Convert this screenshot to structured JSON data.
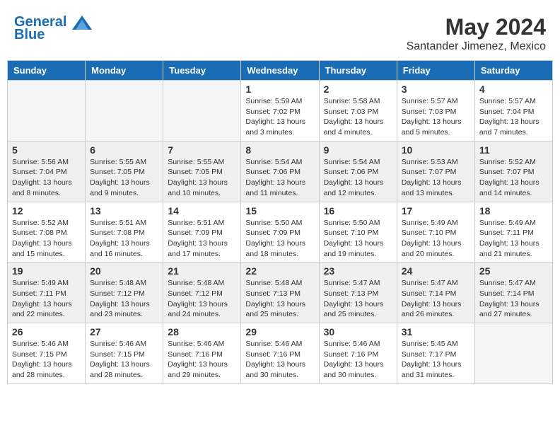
{
  "header": {
    "logo_line1": "General",
    "logo_line2": "Blue",
    "month": "May 2024",
    "location": "Santander Jimenez, Mexico"
  },
  "weekdays": [
    "Sunday",
    "Monday",
    "Tuesday",
    "Wednesday",
    "Thursday",
    "Friday",
    "Saturday"
  ],
  "weeks": [
    [
      {
        "day": "",
        "empty": true
      },
      {
        "day": "",
        "empty": true
      },
      {
        "day": "",
        "empty": true
      },
      {
        "day": "1",
        "sunrise": "Sunrise: 5:59 AM",
        "sunset": "Sunset: 7:02 PM",
        "daylight": "Daylight: 13 hours and 3 minutes."
      },
      {
        "day": "2",
        "sunrise": "Sunrise: 5:58 AM",
        "sunset": "Sunset: 7:03 PM",
        "daylight": "Daylight: 13 hours and 4 minutes."
      },
      {
        "day": "3",
        "sunrise": "Sunrise: 5:57 AM",
        "sunset": "Sunset: 7:03 PM",
        "daylight": "Daylight: 13 hours and 5 minutes."
      },
      {
        "day": "4",
        "sunrise": "Sunrise: 5:57 AM",
        "sunset": "Sunset: 7:04 PM",
        "daylight": "Daylight: 13 hours and 7 minutes."
      }
    ],
    [
      {
        "day": "5",
        "sunrise": "Sunrise: 5:56 AM",
        "sunset": "Sunset: 7:04 PM",
        "daylight": "Daylight: 13 hours and 8 minutes."
      },
      {
        "day": "6",
        "sunrise": "Sunrise: 5:55 AM",
        "sunset": "Sunset: 7:05 PM",
        "daylight": "Daylight: 13 hours and 9 minutes."
      },
      {
        "day": "7",
        "sunrise": "Sunrise: 5:55 AM",
        "sunset": "Sunset: 7:05 PM",
        "daylight": "Daylight: 13 hours and 10 minutes."
      },
      {
        "day": "8",
        "sunrise": "Sunrise: 5:54 AM",
        "sunset": "Sunset: 7:06 PM",
        "daylight": "Daylight: 13 hours and 11 minutes."
      },
      {
        "day": "9",
        "sunrise": "Sunrise: 5:54 AM",
        "sunset": "Sunset: 7:06 PM",
        "daylight": "Daylight: 13 hours and 12 minutes."
      },
      {
        "day": "10",
        "sunrise": "Sunrise: 5:53 AM",
        "sunset": "Sunset: 7:07 PM",
        "daylight": "Daylight: 13 hours and 13 minutes."
      },
      {
        "day": "11",
        "sunrise": "Sunrise: 5:52 AM",
        "sunset": "Sunset: 7:07 PM",
        "daylight": "Daylight: 13 hours and 14 minutes."
      }
    ],
    [
      {
        "day": "12",
        "sunrise": "Sunrise: 5:52 AM",
        "sunset": "Sunset: 7:08 PM",
        "daylight": "Daylight: 13 hours and 15 minutes."
      },
      {
        "day": "13",
        "sunrise": "Sunrise: 5:51 AM",
        "sunset": "Sunset: 7:08 PM",
        "daylight": "Daylight: 13 hours and 16 minutes."
      },
      {
        "day": "14",
        "sunrise": "Sunrise: 5:51 AM",
        "sunset": "Sunset: 7:09 PM",
        "daylight": "Daylight: 13 hours and 17 minutes."
      },
      {
        "day": "15",
        "sunrise": "Sunrise: 5:50 AM",
        "sunset": "Sunset: 7:09 PM",
        "daylight": "Daylight: 13 hours and 18 minutes."
      },
      {
        "day": "16",
        "sunrise": "Sunrise: 5:50 AM",
        "sunset": "Sunset: 7:10 PM",
        "daylight": "Daylight: 13 hours and 19 minutes."
      },
      {
        "day": "17",
        "sunrise": "Sunrise: 5:49 AM",
        "sunset": "Sunset: 7:10 PM",
        "daylight": "Daylight: 13 hours and 20 minutes."
      },
      {
        "day": "18",
        "sunrise": "Sunrise: 5:49 AM",
        "sunset": "Sunset: 7:11 PM",
        "daylight": "Daylight: 13 hours and 21 minutes."
      }
    ],
    [
      {
        "day": "19",
        "sunrise": "Sunrise: 5:49 AM",
        "sunset": "Sunset: 7:11 PM",
        "daylight": "Daylight: 13 hours and 22 minutes."
      },
      {
        "day": "20",
        "sunrise": "Sunrise: 5:48 AM",
        "sunset": "Sunset: 7:12 PM",
        "daylight": "Daylight: 13 hours and 23 minutes."
      },
      {
        "day": "21",
        "sunrise": "Sunrise: 5:48 AM",
        "sunset": "Sunset: 7:12 PM",
        "daylight": "Daylight: 13 hours and 24 minutes."
      },
      {
        "day": "22",
        "sunrise": "Sunrise: 5:48 AM",
        "sunset": "Sunset: 7:13 PM",
        "daylight": "Daylight: 13 hours and 25 minutes."
      },
      {
        "day": "23",
        "sunrise": "Sunrise: 5:47 AM",
        "sunset": "Sunset: 7:13 PM",
        "daylight": "Daylight: 13 hours and 25 minutes."
      },
      {
        "day": "24",
        "sunrise": "Sunrise: 5:47 AM",
        "sunset": "Sunset: 7:14 PM",
        "daylight": "Daylight: 13 hours and 26 minutes."
      },
      {
        "day": "25",
        "sunrise": "Sunrise: 5:47 AM",
        "sunset": "Sunset: 7:14 PM",
        "daylight": "Daylight: 13 hours and 27 minutes."
      }
    ],
    [
      {
        "day": "26",
        "sunrise": "Sunrise: 5:46 AM",
        "sunset": "Sunset: 7:15 PM",
        "daylight": "Daylight: 13 hours and 28 minutes."
      },
      {
        "day": "27",
        "sunrise": "Sunrise: 5:46 AM",
        "sunset": "Sunset: 7:15 PM",
        "daylight": "Daylight: 13 hours and 28 minutes."
      },
      {
        "day": "28",
        "sunrise": "Sunrise: 5:46 AM",
        "sunset": "Sunset: 7:16 PM",
        "daylight": "Daylight: 13 hours and 29 minutes."
      },
      {
        "day": "29",
        "sunrise": "Sunrise: 5:46 AM",
        "sunset": "Sunset: 7:16 PM",
        "daylight": "Daylight: 13 hours and 30 minutes."
      },
      {
        "day": "30",
        "sunrise": "Sunrise: 5:46 AM",
        "sunset": "Sunset: 7:16 PM",
        "daylight": "Daylight: 13 hours and 30 minutes."
      },
      {
        "day": "31",
        "sunrise": "Sunrise: 5:45 AM",
        "sunset": "Sunset: 7:17 PM",
        "daylight": "Daylight: 13 hours and 31 minutes."
      },
      {
        "day": "",
        "empty": true
      }
    ]
  ]
}
